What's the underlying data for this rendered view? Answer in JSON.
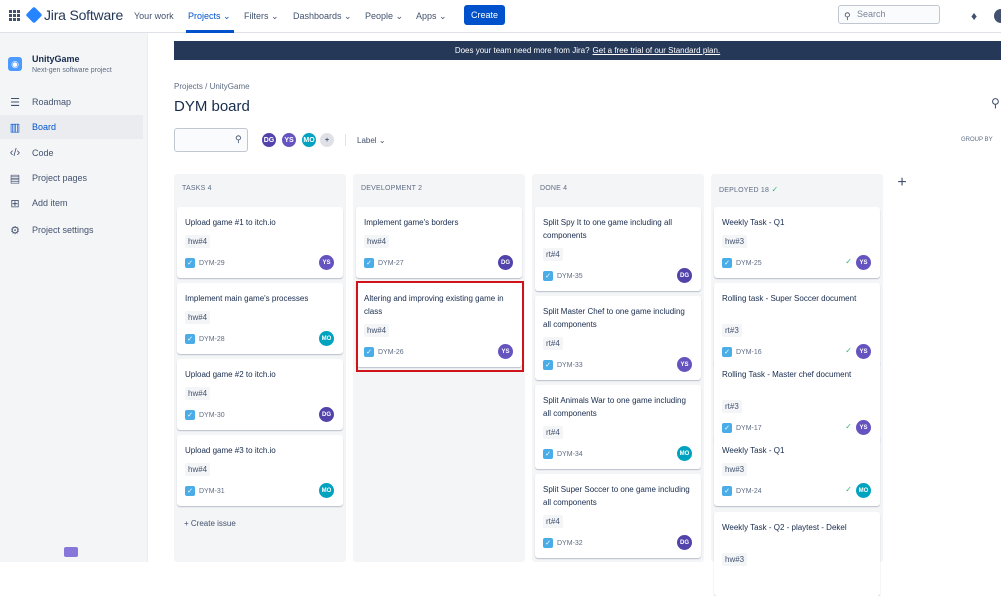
{
  "topnav": {
    "brand": "Jira Software",
    "items": [
      "Your work",
      "Projects",
      "Filters",
      "Dashboards",
      "People",
      "Apps"
    ],
    "create": "Create",
    "search_placeholder": "Search"
  },
  "sidebar": {
    "project_name": "UnityGame",
    "project_type": "Next-gen software project",
    "items": [
      {
        "label": "Roadmap",
        "icon": "roadmap-icon"
      },
      {
        "label": "Board",
        "icon": "board-icon"
      },
      {
        "label": "Code",
        "icon": "code-icon"
      },
      {
        "label": "Project pages",
        "icon": "pages-icon"
      },
      {
        "label": "Add item",
        "icon": "add-item-icon"
      },
      {
        "label": "Project settings",
        "icon": "gear-icon"
      }
    ]
  },
  "banner": {
    "text": "Does your team need more from Jira?",
    "link": "Get a free trial of our Standard plan."
  },
  "breadcrumb": "Projects  /  UnityGame",
  "board_title": "DYM board",
  "filters": {
    "avatars": [
      "DG",
      "YS",
      "MO"
    ],
    "label": "Label",
    "group_by": "GROUP BY"
  },
  "colors": {
    "DG": "#5243aa",
    "YS": "#6554c0",
    "MO": "#00a3bf",
    "accent": "#0052cc",
    "highlight": "#d0121b"
  },
  "columns": [
    {
      "header": "TASKS  4",
      "cards": [
        {
          "title": "Upload game #1 to itch.io",
          "label": "hw#4",
          "key": "DYM-29",
          "assignee": "YS",
          "done": false
        },
        {
          "title": "Implement main game's processes",
          "label": "hw#4",
          "key": "DYM-28",
          "assignee": "MO",
          "done": false
        },
        {
          "title": "Upload game #2 to itch.io",
          "label": "hw#4",
          "key": "DYM-30",
          "assignee": "DG",
          "done": false
        },
        {
          "title": "Upload game #3 to itch.io",
          "label": "hw#4",
          "key": "DYM-31",
          "assignee": "MO",
          "done": false
        }
      ],
      "create": "Create issue"
    },
    {
      "header": "DEVELOPMENT  2",
      "cards": [
        {
          "title": "Implement game's borders",
          "label": "hw#4",
          "key": "DYM-27",
          "assignee": "DG",
          "done": false
        },
        {
          "title": "Altering and improving existing game in class",
          "label": "hw#4",
          "key": "DYM-26",
          "assignee": "YS",
          "done": false
        }
      ]
    },
    {
      "header": "DONE  4",
      "cards": [
        {
          "title": "Split Spy It to one game including all components",
          "label": "rt#4",
          "key": "DYM-35",
          "assignee": "DG",
          "done": false
        },
        {
          "title": "Split Master Chef to one game including all components",
          "label": "rt#4",
          "key": "DYM-33",
          "assignee": "YS",
          "done": false
        },
        {
          "title": "Split Animals War to one game including all components",
          "label": "rt#4",
          "key": "DYM-34",
          "assignee": "MO",
          "done": false
        },
        {
          "title": "Split Super Soccer to one game including all components",
          "label": "rt#4",
          "key": "DYM-32",
          "assignee": "DG",
          "done": false
        }
      ]
    },
    {
      "header": "DEPLOYED  18",
      "cards": [
        {
          "title": "Weekly Task - Q1",
          "label": "hw#3",
          "key": "DYM-25",
          "assignee": "YS",
          "done": true
        },
        {
          "title": "Rolling task - Super Soccer document",
          "label": "rt#3",
          "key": "DYM-16",
          "assignee": "YS",
          "done": true
        },
        {
          "title": "Rolling Task - Master chef document",
          "label": "rt#3",
          "key": "DYM-17",
          "assignee": "YS",
          "done": true
        },
        {
          "title": "Weekly Task - Q1",
          "label": "hw#3",
          "key": "DYM-24",
          "assignee": "MO",
          "done": true
        },
        {
          "title": "Weekly Task - Q2 - playtest - Dekel",
          "label": "hw#3",
          "key": "",
          "assignee": "",
          "done": false
        }
      ]
    }
  ]
}
